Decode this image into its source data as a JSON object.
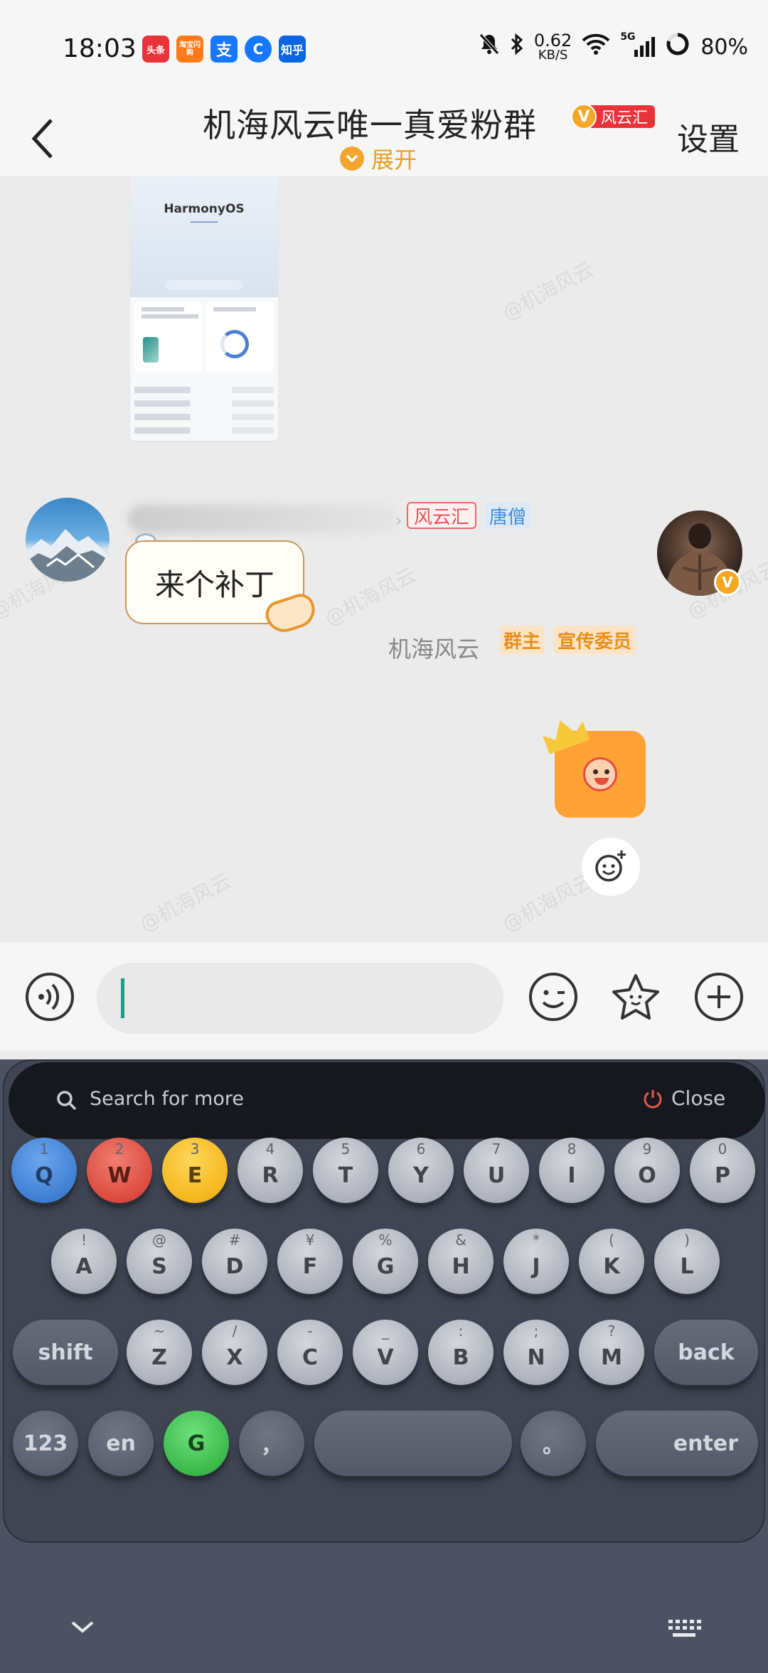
{
  "status_bar": {
    "time": "18:03",
    "app_icons": [
      {
        "label": "头条",
        "color": "#e8333a"
      },
      {
        "label": "淘宝闪购",
        "color": "#ff7a1a"
      },
      {
        "label": "支",
        "color": "#1677ff"
      },
      {
        "label": "C",
        "color": "#1677ff"
      },
      {
        "label": "知乎",
        "color": "#0a66e0"
      }
    ],
    "net_speed_value": "0.62",
    "net_speed_unit": "KB/S",
    "network": "5G",
    "battery": "80%"
  },
  "header": {
    "group_name": "机海风云唯一真爱粉群",
    "badge_v": "V",
    "badge_label": "风云汇",
    "settings": "设置",
    "expand": "展开"
  },
  "chat": {
    "shared_image": {
      "title": "HarmonyOS"
    },
    "messages": [
      {
        "side": "left",
        "tags": [
          "风云汇",
          "唐僧"
        ],
        "text": "来个补丁"
      },
      {
        "side": "right",
        "sender": "机海风云",
        "tags": [
          "群主",
          "宣传委员"
        ],
        "sticker": "emoji-sticker"
      }
    ],
    "watermark": "@机海风云"
  },
  "input_bar": {
    "placeholder": ""
  },
  "keyboard": {
    "search_placeholder": "Search for more",
    "close_label": "Close",
    "row1": [
      {
        "sub": "1",
        "main": "Q",
        "color": "blue"
      },
      {
        "sub": "2",
        "main": "W",
        "color": "red"
      },
      {
        "sub": "3",
        "main": "E",
        "color": "yellow"
      },
      {
        "sub": "4",
        "main": "R",
        "color": "grey"
      },
      {
        "sub": "5",
        "main": "T",
        "color": "grey"
      },
      {
        "sub": "6",
        "main": "Y",
        "color": "grey"
      },
      {
        "sub": "7",
        "main": "U",
        "color": "grey"
      },
      {
        "sub": "8",
        "main": "I",
        "color": "grey"
      },
      {
        "sub": "9",
        "main": "O",
        "color": "grey"
      },
      {
        "sub": "0",
        "main": "P",
        "color": "grey"
      }
    ],
    "row2": [
      {
        "sub": "!",
        "main": "A"
      },
      {
        "sub": "@",
        "main": "S"
      },
      {
        "sub": "#",
        "main": "D"
      },
      {
        "sub": "¥",
        "main": "F"
      },
      {
        "sub": "%",
        "main": "G"
      },
      {
        "sub": "&",
        "main": "H"
      },
      {
        "sub": "*",
        "main": "J"
      },
      {
        "sub": "(",
        "main": "K"
      },
      {
        "sub": ")",
        "main": "L"
      }
    ],
    "row3": [
      {
        "sub": "~",
        "main": "Z"
      },
      {
        "sub": "/",
        "main": "X"
      },
      {
        "sub": "-",
        "main": "C"
      },
      {
        "sub": "_",
        "main": "V"
      },
      {
        "sub": ":",
        "main": "B"
      },
      {
        "sub": ";",
        "main": "N"
      },
      {
        "sub": "?",
        "main": "M"
      }
    ],
    "shift": "shift",
    "back": "back",
    "num": "123",
    "lang": "en",
    "g_key": "G",
    "comma": "，",
    "period": "。",
    "enter": "enter"
  }
}
